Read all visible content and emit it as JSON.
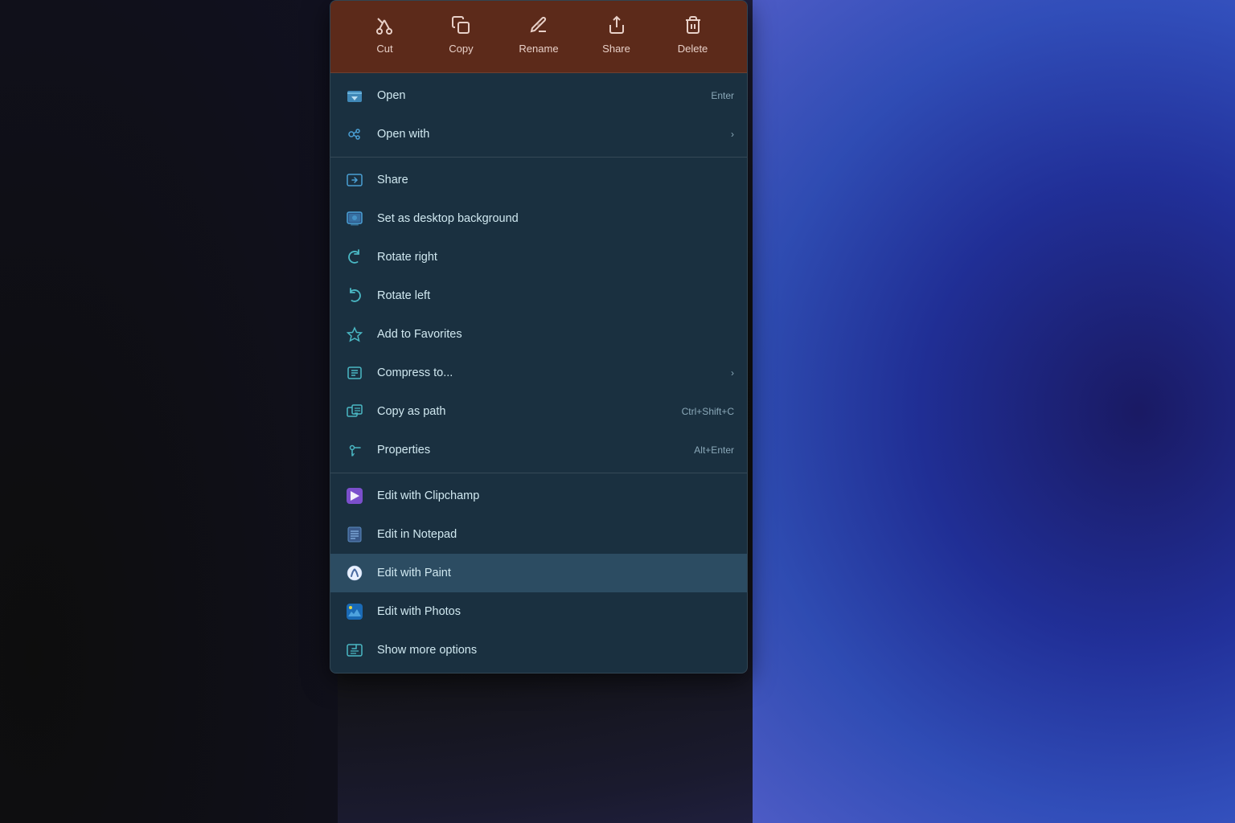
{
  "background": {
    "desc": "Windows 11 desktop with dark gradient"
  },
  "toolbar": {
    "items": [
      {
        "id": "cut",
        "label": "Cut",
        "icon": "✂"
      },
      {
        "id": "copy",
        "label": "Copy",
        "icon": "⧉"
      },
      {
        "id": "rename",
        "label": "Rename",
        "icon": "✎"
      },
      {
        "id": "share",
        "label": "Share",
        "icon": "↗"
      },
      {
        "id": "delete",
        "label": "Delete",
        "icon": "🗑"
      }
    ]
  },
  "menu_sections": [
    {
      "id": "section1",
      "items": [
        {
          "id": "open",
          "label": "Open",
          "shortcut": "Enter",
          "has_arrow": false,
          "active": false
        },
        {
          "id": "open-with",
          "label": "Open with",
          "shortcut": "",
          "has_arrow": true,
          "active": false
        }
      ]
    },
    {
      "id": "section2",
      "items": [
        {
          "id": "share",
          "label": "Share",
          "shortcut": "",
          "has_arrow": false,
          "active": false
        },
        {
          "id": "set-desktop-bg",
          "label": "Set as desktop background",
          "shortcut": "",
          "has_arrow": false,
          "active": false
        },
        {
          "id": "rotate-right",
          "label": "Rotate right",
          "shortcut": "",
          "has_arrow": false,
          "active": false
        },
        {
          "id": "rotate-left",
          "label": "Rotate left",
          "shortcut": "",
          "has_arrow": false,
          "active": false
        },
        {
          "id": "add-favorites",
          "label": "Add to Favorites",
          "shortcut": "",
          "has_arrow": false,
          "active": false
        },
        {
          "id": "compress-to",
          "label": "Compress to...",
          "shortcut": "",
          "has_arrow": true,
          "active": false
        },
        {
          "id": "copy-as-path",
          "label": "Copy as path",
          "shortcut": "Ctrl+Shift+C",
          "has_arrow": false,
          "active": false
        },
        {
          "id": "properties",
          "label": "Properties",
          "shortcut": "Alt+Enter",
          "has_arrow": false,
          "active": false
        }
      ]
    },
    {
      "id": "section3",
      "items": [
        {
          "id": "edit-clipchamp",
          "label": "Edit with Clipchamp",
          "shortcut": "",
          "has_arrow": false,
          "active": false
        },
        {
          "id": "edit-notepad",
          "label": "Edit in Notepad",
          "shortcut": "",
          "has_arrow": false,
          "active": false
        },
        {
          "id": "edit-paint",
          "label": "Edit with Paint",
          "shortcut": "",
          "has_arrow": false,
          "active": true
        },
        {
          "id": "edit-photos",
          "label": "Edit with Photos",
          "shortcut": "",
          "has_arrow": false,
          "active": false
        },
        {
          "id": "show-more",
          "label": "Show more options",
          "shortcut": "",
          "has_arrow": false,
          "active": false
        }
      ]
    }
  ]
}
